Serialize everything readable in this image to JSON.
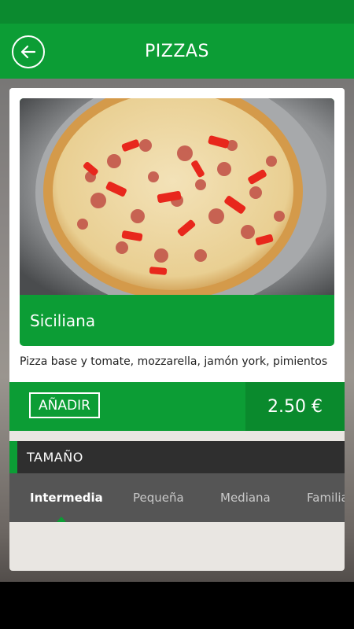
{
  "app_bar": {
    "title": "PIZZAS",
    "back_icon": "arrow-left-icon"
  },
  "product": {
    "name": "Siciliana",
    "description": "Pizza base y tomate, mozzarella, jamón york, pimientos",
    "add_label": "AÑADIR",
    "price": "2.50 €"
  },
  "size_section": {
    "title": "TAMAÑO",
    "tabs": [
      {
        "label": "Intermedia",
        "selected": true
      },
      {
        "label": "Pequeña",
        "selected": false
      },
      {
        "label": "Mediana",
        "selected": false
      },
      {
        "label": "Familiar",
        "selected": false
      }
    ]
  },
  "colors": {
    "primary": "#0c9d35",
    "primary_dark": "#0a8a2d",
    "status_bar": "#0b8a2f",
    "tab_bg": "#555555",
    "header_bg": "#2f2f2f"
  }
}
